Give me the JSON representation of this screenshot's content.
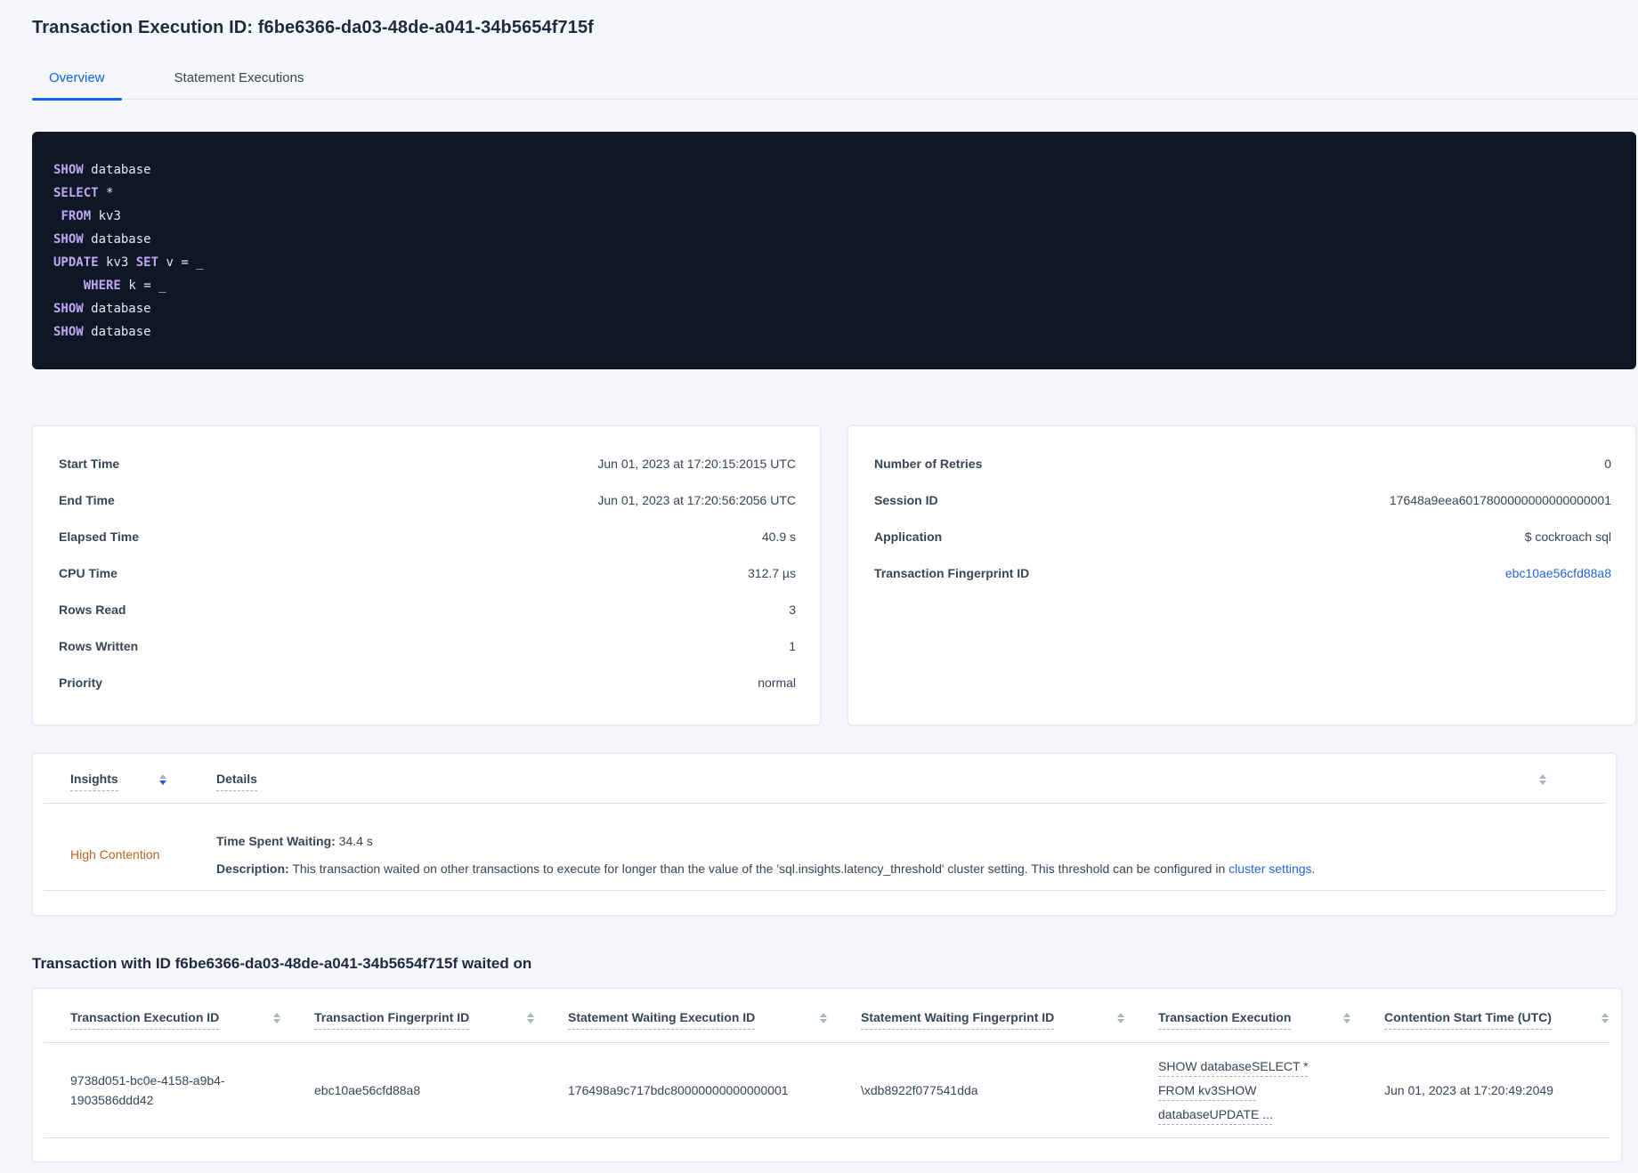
{
  "colors": {
    "page_bg": "#F5F7FA",
    "title": "#1E2A3E",
    "text": "#394455",
    "tab_blue": "#0D62EB",
    "link_blue": "#2665E0",
    "orange": "#C2621C",
    "code_bg": "#0D1726",
    "code_kw": "#C1A6F2",
    "code_text": "#E9E6F4",
    "divider": "#D9DEE5",
    "dash": "#A6B0C2",
    "icon_gray": "#AAB4C3",
    "icon_blue": "#2157E0"
  },
  "header": {
    "title": "Transaction Execution ID: f6be6366-da03-48de-a041-34b5654f715f"
  },
  "tabs": {
    "overview": "Overview",
    "statement_executions": "Statement Executions"
  },
  "sql": {
    "keywords": [
      "SHOW",
      "SELECT",
      "FROM",
      "UPDATE",
      "SET",
      "WHERE"
    ],
    "lines": [
      "SHOW database",
      "SELECT *",
      " FROM kv3",
      "SHOW database",
      "UPDATE kv3 SET v = _",
      "    WHERE k = _",
      "SHOW database",
      "SHOW database"
    ]
  },
  "details_left": {
    "rows": [
      {
        "label": "Start Time",
        "value": "Jun 01, 2023 at 17:20:15:2015 UTC"
      },
      {
        "label": "End Time",
        "value": "Jun 01, 2023 at 17:20:56:2056 UTC"
      },
      {
        "label": "Elapsed Time",
        "value": "40.9 s"
      },
      {
        "label": "CPU Time",
        "value": "312.7 µs"
      },
      {
        "label": "Rows Read",
        "value": "3"
      },
      {
        "label": "Rows Written",
        "value": "1"
      },
      {
        "label": "Priority",
        "value": "normal"
      }
    ]
  },
  "details_right": {
    "rows": [
      {
        "label": "Number of Retries",
        "value": "0"
      },
      {
        "label": "Session ID",
        "value": "17648a9eea6017800000000000000001"
      },
      {
        "label": "Application",
        "value": "$ cockroach sql"
      },
      {
        "label": "Transaction Fingerprint ID",
        "value": "ebc10ae56cfd88a8"
      }
    ]
  },
  "insights": {
    "columns": {
      "insights": "Insights",
      "details": "Details"
    },
    "row": {
      "insight": "High Contention",
      "waiting_label": "Time Spent Waiting:",
      "waiting_value": " 34.4 s",
      "description_label": "Description:",
      "description_text": " This transaction waited on other transactions to execute for longer than the value of the 'sql.insights.latency_threshold' cluster setting. This threshold can be configured in ",
      "description_link": "cluster settings",
      "description_suffix": "."
    }
  },
  "waited_on": {
    "heading": "Transaction with ID f6be6366-da03-48de-a041-34b5654f715f waited on",
    "columns": [
      "Transaction Execution ID",
      "Transaction Fingerprint ID",
      "Statement Waiting Execution ID",
      "Statement Waiting Fingerprint ID",
      "Transaction Execution",
      "Contention Start Time (UTC)"
    ],
    "row": {
      "transaction_execution_id": "9738d051-bc0e-4158-a9b4-1903586ddd42",
      "transaction_fingerprint_id": "ebc10ae56cfd88a8",
      "statement_waiting_execution_id": "176498a9c717bdc80000000000000001",
      "statement_waiting_fingerprint_id": "\\xdb8922f077541dda",
      "transaction_execution": "SHOW databaseSELECT *\nFROM kv3SHOW\ndatabaseUPDATE ...",
      "contention_start_time": "Jun 01, 2023 at 17:20:49:2049"
    }
  }
}
